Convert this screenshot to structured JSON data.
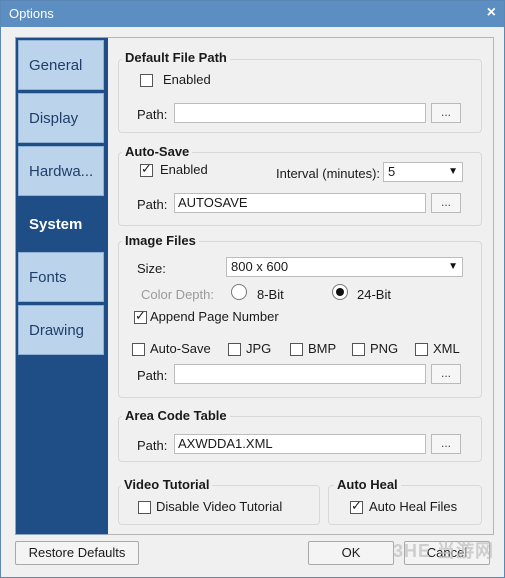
{
  "window": {
    "title": "Options",
    "close_glyph": "×"
  },
  "tabs": [
    {
      "label": "General"
    },
    {
      "label": "Display"
    },
    {
      "label": "Hardwa..."
    },
    {
      "label": "System",
      "active": true
    },
    {
      "label": "Fonts"
    },
    {
      "label": "Drawing"
    }
  ],
  "default_file_path": {
    "title": "Default File Path",
    "enabled_label": "Enabled",
    "enabled_checked": false,
    "path_label": "Path:",
    "path_value": "",
    "browse": "..."
  },
  "auto_save": {
    "title": "Auto-Save",
    "enabled_label": "Enabled",
    "enabled_checked": true,
    "interval_label": "Interval (minutes):",
    "interval_value": "5",
    "path_label": "Path:",
    "path_value": "AUTOSAVE",
    "browse": "..."
  },
  "image_files": {
    "title": "Image Files",
    "size_label": "Size:",
    "size_value": "800 x 600",
    "color_depth_label": "Color Depth:",
    "depth_8": "8-Bit",
    "depth_24": "24-Bit",
    "depth_selected": "24-Bit",
    "append_label": "Append Page Number",
    "append_checked": true,
    "formats": [
      {
        "label": "Auto-Save",
        "checked": false
      },
      {
        "label": "JPG",
        "checked": false
      },
      {
        "label": "BMP",
        "checked": false
      },
      {
        "label": "PNG",
        "checked": false
      },
      {
        "label": "XML",
        "checked": false
      }
    ],
    "path_label": "Path:",
    "path_value": "",
    "browse": "..."
  },
  "area_code": {
    "title": "Area Code Table",
    "path_label": "Path:",
    "path_value": "AXWDDA1.XML",
    "browse": "..."
  },
  "video_tutorial": {
    "title": "Video Tutorial",
    "disable_label": "Disable Video Tutorial",
    "disable_checked": false
  },
  "auto_heal": {
    "title": "Auto Heal",
    "files_label": "Auto Heal Files",
    "files_checked": true
  },
  "footer": {
    "restore": "Restore Defaults",
    "ok": "OK",
    "cancel": "Cancel"
  },
  "watermark": "3HE 当游网",
  "colors": {
    "title_bar": "#5d8ec2",
    "tab_strip": "#1f4d86",
    "tab": "#bcd3ec"
  }
}
